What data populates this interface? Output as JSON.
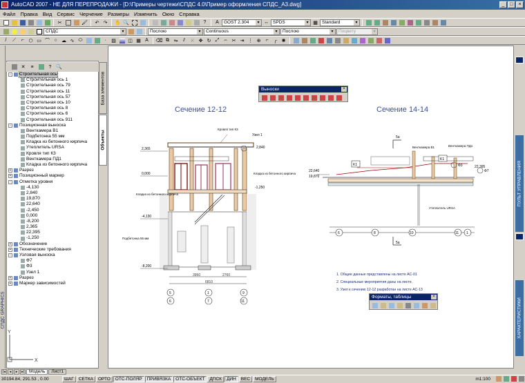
{
  "window": {
    "title": "AutoCAD 2007 - НЕ ДЛЯ ПЕРЕПРОДАЖИ - [D:\\Примеры чертежи\\СПДС 4.0\\Пример оформления СПДС_А3.dwg]"
  },
  "menu": [
    "Файл",
    "Правка",
    "Вид",
    "Сервис",
    "Черчение",
    "Размеры",
    "Изменить",
    "Окно",
    "Справка"
  ],
  "toolbars": {
    "row1": {
      "text_style": "GOST 2.304",
      "dim_style": "SPDS",
      "table_style": "Standard"
    },
    "row2": {
      "layer": "СПДС",
      "color": "Послою",
      "linetype": "Continuous",
      "lineweight": "Послою",
      "plotstyle": "Поцвету"
    }
  },
  "side_panel": {
    "tabs": [
      "База элементов",
      "Объекты"
    ],
    "tree": [
      {
        "level": 0,
        "exp": "-",
        "label": "Строительная ось",
        "selected": true
      },
      {
        "level": 2,
        "label": "Строительная ось 1"
      },
      {
        "level": 2,
        "label": "Строительная ось 79"
      },
      {
        "level": 2,
        "label": "Строительная ось 11"
      },
      {
        "level": 2,
        "label": "Строительная ось 57"
      },
      {
        "level": 2,
        "label": "Строительная ось 10"
      },
      {
        "level": 2,
        "label": "Строительная ось 8"
      },
      {
        "level": 2,
        "label": "Строительная ось 6"
      },
      {
        "level": 2,
        "label": "Строительная ось 911"
      },
      {
        "level": 0,
        "exp": "-",
        "label": "Позиционная выноска"
      },
      {
        "level": 2,
        "label": "Венткамера В1"
      },
      {
        "level": 2,
        "label": "Подбетонка 55 мм"
      },
      {
        "level": 2,
        "label": "Кладка из бетонного кирпича"
      },
      {
        "level": 2,
        "label": "Утеплитель URSA"
      },
      {
        "level": 2,
        "label": "Кровля тип К3"
      },
      {
        "level": 2,
        "label": "Венткамера ПД1"
      },
      {
        "level": 2,
        "label": "Кладка из бетонного кирпича"
      },
      {
        "level": 0,
        "exp": "+",
        "label": "Разрез"
      },
      {
        "level": 0,
        "exp": "+",
        "label": "Позиционный маркер"
      },
      {
        "level": 0,
        "exp": "-",
        "label": "Отметка уровня"
      },
      {
        "level": 2,
        "label": "-4,130"
      },
      {
        "level": 2,
        "label": "2,840"
      },
      {
        "level": 2,
        "label": "19,870"
      },
      {
        "level": 2,
        "label": "22,640"
      },
      {
        "level": 2,
        "label": "-2,450"
      },
      {
        "level": 2,
        "label": "0,000"
      },
      {
        "level": 2,
        "label": "-8,200"
      },
      {
        "level": 2,
        "label": "2,365"
      },
      {
        "level": 2,
        "label": "22,395"
      },
      {
        "level": 2,
        "label": "-1,250"
      },
      {
        "level": 0,
        "exp": "+",
        "label": "Обозначение"
      },
      {
        "level": 0,
        "exp": "+",
        "label": "Технические требования"
      },
      {
        "level": 0,
        "exp": "-",
        "label": "Узловая выноска"
      },
      {
        "level": 2,
        "label": "Ф7"
      },
      {
        "level": 2,
        "label": "Ф3"
      },
      {
        "level": 2,
        "label": "Узел 1"
      },
      {
        "level": 0,
        "exp": "+",
        "label": "Разрез"
      },
      {
        "level": 0,
        "exp": "+",
        "label": "Маркер зависимостей"
      }
    ]
  },
  "left_strip_label": "СПДС GRAPHICS",
  "right_tabs": [
    "ПУЛЬТ УПРАВЛЕНИЯ",
    "ХАРАКТЕРИСТИКИ"
  ],
  "floating": {
    "vynoski": "Выноски",
    "formats": "Форматы, таблицы"
  },
  "drawing": {
    "section1_title": "Сечение 12-12",
    "section2_title": "Сечение 14-14",
    "notes": [
      "1. Общие данные представлены на листе АС-01",
      "2. Специальные мероприятия даны на листе.",
      "3. Узел к сечению 12-12 разработан на листе АС-13"
    ],
    "node_label": "Узел 1",
    "marks1": [
      "2,365",
      "0,000",
      "-4,130",
      "-8,200"
    ],
    "marks1_right": [
      "2,840",
      "-1,250"
    ],
    "labels1": [
      "Кровля тип К3",
      "Кладка из бетонного кирпича",
      "Кладка из бетонного кирпича",
      "Подбетонка 55 мм"
    ],
    "dims1": [
      "3950",
      "2760",
      "6810"
    ],
    "axes1": [
      "5",
      "7",
      "1",
      "9",
      "6",
      "11"
    ],
    "marks2": [
      "22,640",
      "19,870",
      "22,395"
    ],
    "labels2": [
      "Венткамера В1",
      "Венткамера ПД1",
      "Утеплитель URSA",
      "Ф3",
      "Ф7",
      "K1",
      "K1"
    ],
    "axes2": [
      "6",
      "8",
      "10",
      "11",
      "1"
    ],
    "sa": [
      "5а",
      "5а"
    ],
    "ucs_y": "Y",
    "ucs_x": "X"
  },
  "sheets": [
    "Модель",
    "Лист1"
  ],
  "status": {
    "coords": "30194.84, 291.53 , 0.00",
    "buttons": [
      "ШАГ",
      "СЕТКА",
      "ОРТО",
      "ОТС-ПОЛЯР",
      "ПРИВЯЗКА",
      "ОТС-ОБЪЕКТ",
      "ДПСК",
      "ДИН",
      "ВЕС",
      "МОДЕЛЬ"
    ],
    "scale": "m1:100"
  }
}
